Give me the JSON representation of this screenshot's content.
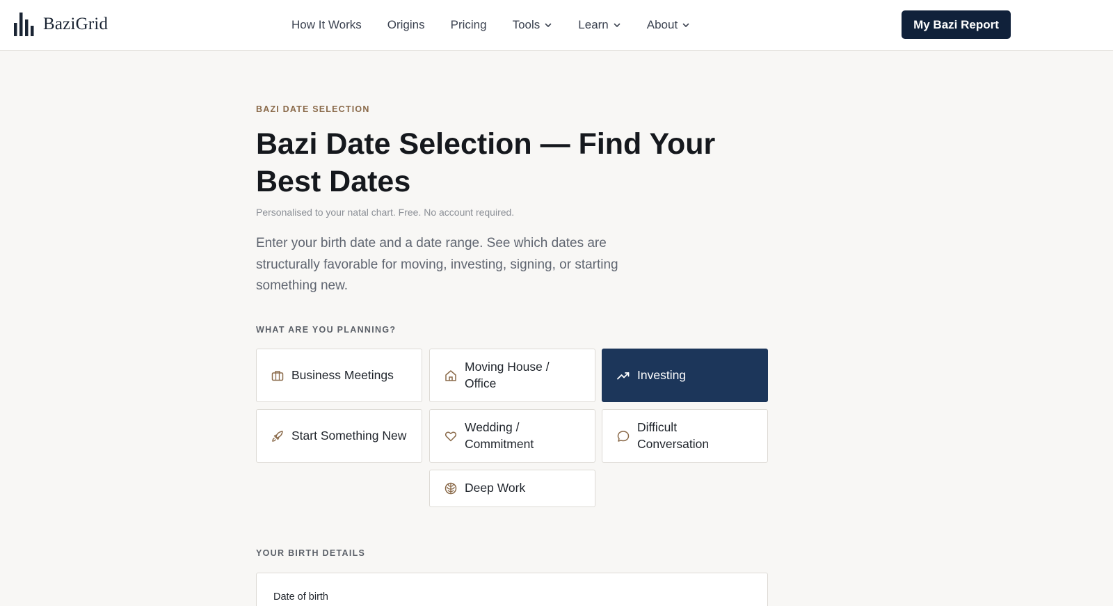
{
  "header": {
    "logo_text": "BaziGrid",
    "nav": [
      {
        "label": "How It Works",
        "dropdown": false
      },
      {
        "label": "Origins",
        "dropdown": false
      },
      {
        "label": "Pricing",
        "dropdown": false
      },
      {
        "label": "Tools",
        "dropdown": true
      },
      {
        "label": "Learn",
        "dropdown": true
      },
      {
        "label": "About",
        "dropdown": true
      }
    ],
    "cta_label": "My Bazi Report"
  },
  "main": {
    "eyebrow": "BAZI DATE SELECTION",
    "title": "Bazi Date Selection — Find Your Best Dates",
    "subnote": "Personalised to your natal chart. Free. No account required.",
    "lede": "Enter your birth date and a date range. See which dates are structurally favorable for moving, investing, signing, or starting something new.",
    "planning_label": "WHAT ARE YOU PLANNING?",
    "options": [
      {
        "label": "Business Meetings",
        "icon": "briefcase-icon",
        "selected": false
      },
      {
        "label": "Moving House / Office",
        "icon": "house-icon",
        "selected": false
      },
      {
        "label": "Investing",
        "icon": "trending-up-icon",
        "selected": true
      },
      {
        "label": "Start Something New",
        "icon": "rocket-icon",
        "selected": false
      },
      {
        "label": "Wedding / Commitment",
        "icon": "heart-icon",
        "selected": false
      },
      {
        "label": "Difficult Conversation",
        "icon": "chat-bubble-icon",
        "selected": false
      },
      {
        "label": "Deep Work",
        "icon": "brain-icon",
        "selected": false
      }
    ],
    "birth_label": "YOUR BIRTH DETAILS",
    "dob_label": "Date of birth"
  },
  "colors": {
    "navy": "#10213a",
    "selected_bg": "#1c365a",
    "eyebrow": "#8a6a4a",
    "icon_brown": "#8a6a4a",
    "background": "#f8f7f5"
  }
}
